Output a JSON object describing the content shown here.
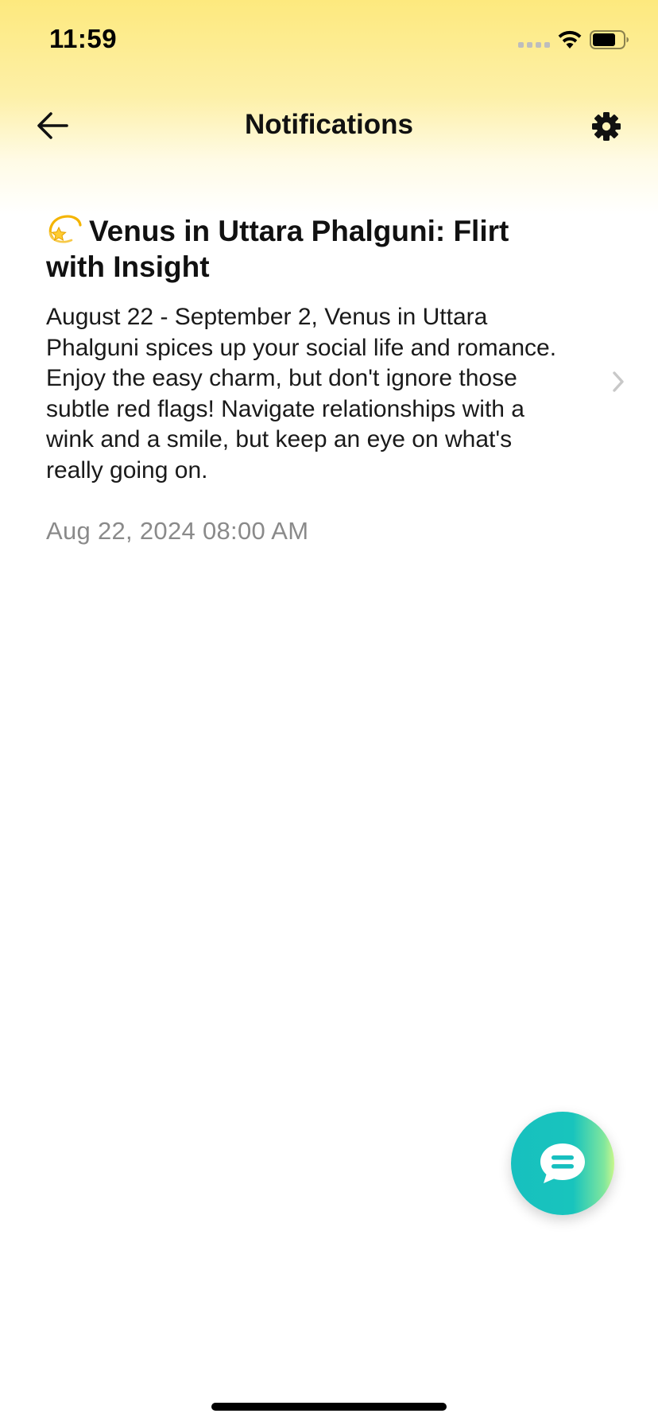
{
  "status_bar": {
    "time": "11:59"
  },
  "header": {
    "title": "Notifications",
    "back_icon": "arrow-left-icon",
    "settings_icon": "gear-icon"
  },
  "notifications": [
    {
      "emoji": "dizzy-star",
      "title": "Venus in Uttara Phalguni: Flirt with Insight",
      "body": "August 22 - September 2, Venus in Uttara Phalguni spices up your social life and romance. Enjoy the easy charm, but don't ignore those subtle red flags! Navigate relationships with a wink and a smile, but keep an eye on what's really going on.",
      "date": "Aug 22, 2024 08:00 AM"
    }
  ],
  "chat_button": {
    "icon": "chat-bubble-icon"
  },
  "colors": {
    "header_gradient_top": "#fde97e",
    "date_text": "#8a8a8a",
    "fab_start": "#17c0bf",
    "fab_end": "#c9f78c"
  }
}
